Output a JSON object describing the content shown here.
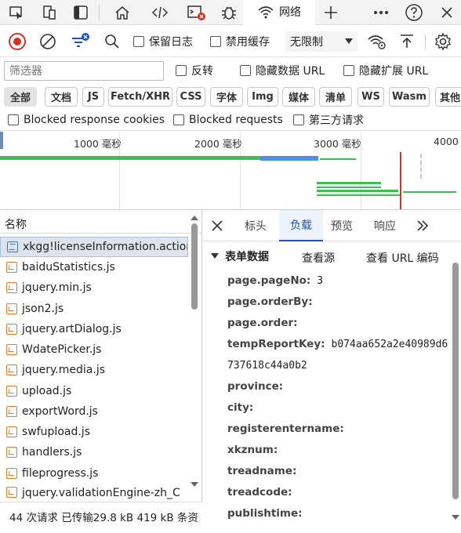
{
  "tabstrip": {
    "network_label": "网络",
    "icons": [
      "inspect-icon",
      "device-emulation-icon",
      "dock-panel-icon",
      "home-icon",
      "elements-icon",
      "console-icon",
      "debugger-bug-icon",
      "network-wifi-icon",
      "add-tab-icon",
      "more-icon",
      "help-icon",
      "close-icon"
    ]
  },
  "toolbar": {
    "preserve_log": "保留日志",
    "disable_cache": "禁用缓存",
    "throttle": "无限制"
  },
  "filter": {
    "placeholder": "筛选器",
    "invert": "反转",
    "hide_data_url": "隐藏数据 URL",
    "hide_ext_url": "隐藏扩展 URL"
  },
  "types": [
    "全部",
    "文档",
    "JS",
    "Fetch/XHR",
    "CSS",
    "字体",
    "Img",
    "媒体",
    "清单",
    "WS",
    "Wasm",
    "其他"
  ],
  "blocked": {
    "cookies": "Blocked response cookies",
    "requests": "Blocked requests",
    "third_party": "第三方请求"
  },
  "timeline": {
    "ticks": [
      "1000  毫秒",
      "2000  毫秒",
      "3000  毫秒",
      "4000"
    ]
  },
  "requests": {
    "header": "名称",
    "items": [
      {
        "name": "xkgg!licenseInformation.action",
        "type": "doc"
      },
      {
        "name": "baiduStatistics.js",
        "type": "js"
      },
      {
        "name": "jquery.min.js",
        "type": "js"
      },
      {
        "name": "json2.js",
        "type": "js"
      },
      {
        "name": "jquery.artDialog.js",
        "type": "js"
      },
      {
        "name": "WdatePicker.js",
        "type": "js"
      },
      {
        "name": "jquery.media.js",
        "type": "js"
      },
      {
        "name": "upload.js",
        "type": "js"
      },
      {
        "name": "exportWord.js",
        "type": "js"
      },
      {
        "name": "swfupload.js",
        "type": "js"
      },
      {
        "name": "handlers.js",
        "type": "js"
      },
      {
        "name": "fileprogress.js",
        "type": "js"
      },
      {
        "name": "jquery.validationEngine-zh_C",
        "type": "js"
      }
    ]
  },
  "status": {
    "text": "44 次请求  已传输29.8 kB  419 kB 条资"
  },
  "detail": {
    "tabs": [
      "标头",
      "负载",
      "预览",
      "响应"
    ],
    "active_tab": "负载",
    "form_title": "表单数据",
    "view_source": "查看源",
    "view_url_encoded": "查看 URL 编码",
    "fields": [
      {
        "key": "page.pageNo:",
        "value": "3"
      },
      {
        "key": "page.orderBy:",
        "value": ""
      },
      {
        "key": "page.order:",
        "value": ""
      },
      {
        "key": "tempReportKey:",
        "value": "b074aa652a2e40989d6"
      },
      {
        "key": "",
        "value": "737618c44a0b2"
      },
      {
        "key": "province:",
        "value": ""
      },
      {
        "key": "city:",
        "value": ""
      },
      {
        "key": "registerentername:",
        "value": ""
      },
      {
        "key": "xkznum:",
        "value": ""
      },
      {
        "key": "treadname:",
        "value": ""
      },
      {
        "key": "treadcode:",
        "value": ""
      },
      {
        "key": "publishtime:",
        "value": ""
      }
    ]
  },
  "colors": {
    "accent": "#1a56b8",
    "record": "#d93025",
    "bar_green": "#3cbf4f",
    "bar_blue": "#4d8fe8",
    "load_line": "#c0392b"
  }
}
